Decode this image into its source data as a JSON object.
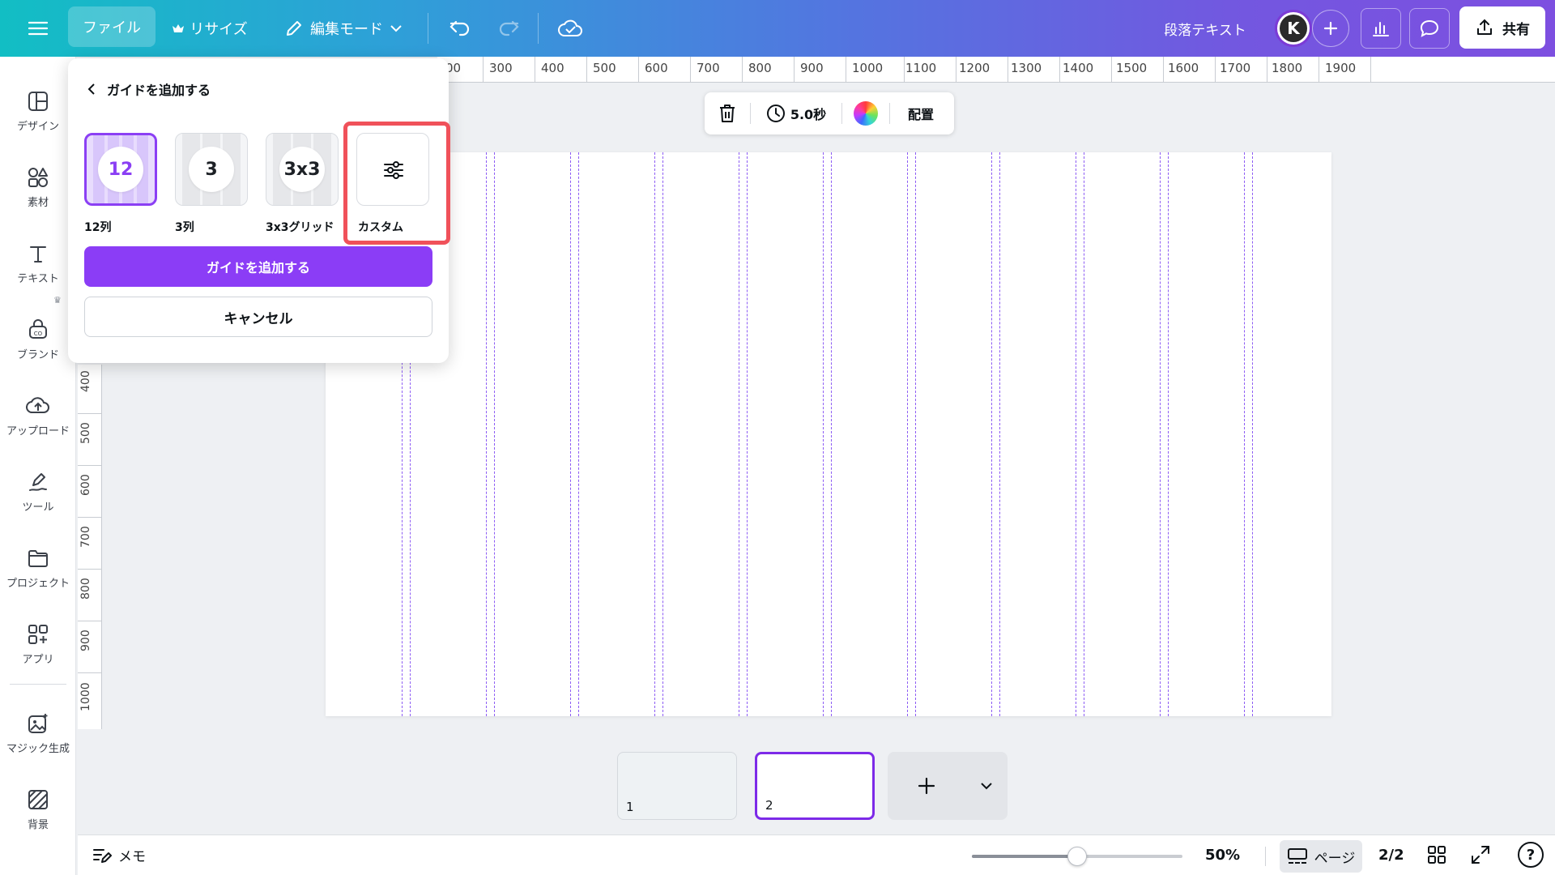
{
  "topbar": {
    "file_label": "ファイル",
    "resize_label": "リサイズ",
    "edit_mode_label": "編集モード",
    "doc_title": "段落テキスト",
    "avatar_initial": "K",
    "share_label": "共有"
  },
  "sidebar": {
    "items": [
      {
        "label": "デザイン",
        "icon": "layout-icon"
      },
      {
        "label": "素材",
        "icon": "elements-icon"
      },
      {
        "label": "テキスト",
        "icon": "text-icon"
      },
      {
        "label": "ブランド",
        "icon": "brand-icon"
      },
      {
        "label": "アップロード",
        "icon": "upload-cloud-icon"
      },
      {
        "label": "ツール",
        "icon": "pen-tool-icon"
      },
      {
        "label": "プロジェクト",
        "icon": "folder-icon"
      },
      {
        "label": "アプリ",
        "icon": "apps-icon"
      },
      {
        "label": "マジック生成",
        "icon": "magic-media-icon"
      },
      {
        "label": "背景",
        "icon": "background-icon"
      }
    ]
  },
  "ruler_top": {
    "labels": [
      "00",
      "300",
      "400",
      "500",
      "600",
      "700",
      "800",
      "900",
      "1000",
      "1100",
      "1200",
      "1300",
      "1400",
      "1500",
      "1600",
      "1700",
      "1800",
      "1900"
    ]
  },
  "ruler_left": {
    "labels": [
      "400",
      "500",
      "600",
      "700",
      "800",
      "900",
      "1000"
    ]
  },
  "context_toolbar": {
    "duration_label": "5.0秒",
    "position_label": "配置"
  },
  "guides_popup": {
    "title": "ガイドを追加する",
    "options": [
      {
        "badge": "12",
        "label": "12列"
      },
      {
        "badge": "3",
        "label": "3列"
      },
      {
        "badge": "3x3",
        "label": "3x3グリッド"
      },
      {
        "badge": "",
        "label": "カスタム"
      }
    ],
    "selected_option": "12列",
    "add_button_label": "ガイドを追加する",
    "cancel_button_label": "キャンセル"
  },
  "pages": {
    "items": [
      {
        "number": "1"
      },
      {
        "number": "2"
      }
    ],
    "active_page": "2"
  },
  "bottombar": {
    "notes_label": "メモ",
    "zoom_value": "50%",
    "zoom_level": 0.5,
    "pages_label": "ページ",
    "page_count": "2/2",
    "help_label": "?"
  },
  "colors": {
    "accent": "#7d2ae8",
    "guide_line": "#8d5cf4",
    "highlight_box": "#f0515a",
    "primary_button": "#8b3df6"
  }
}
